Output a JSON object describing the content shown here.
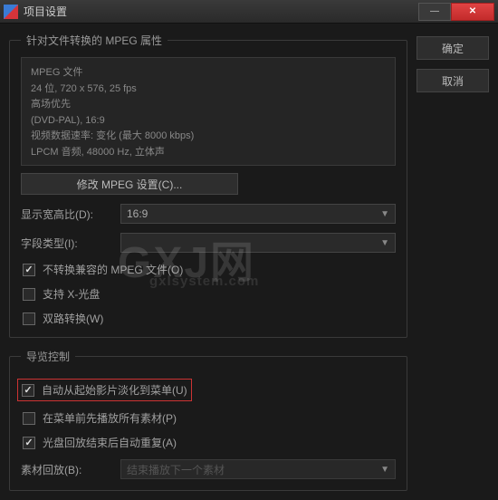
{
  "window": {
    "title": "项目设置"
  },
  "buttons": {
    "ok": "确定",
    "cancel": "取消",
    "modify_mpeg": "修改 MPEG 设置(C)..."
  },
  "mpeg_section": {
    "legend": "针对文件转换的 MPEG 属性",
    "info": {
      "line1": "MPEG 文件",
      "line2": "24 位, 720 x 576, 25 fps",
      "line3": "高场优先",
      "line4": "(DVD-PAL), 16:9",
      "line5": "视频数据速率: 变化 (最大 8000 kbps)",
      "line6": "LPCM 音频, 48000 Hz, 立体声"
    },
    "aspect_label": "显示宽高比(D):",
    "aspect_value": "16:9",
    "field_label": "字段类型(I):",
    "field_value": "",
    "chk_no_convert": "不转换兼容的 MPEG 文件(O)",
    "chk_xdisc": "支持 X-光盘",
    "chk_dualpass": "双路转换(W)"
  },
  "nav_section": {
    "legend": "导览控制",
    "chk_fade": "自动从起始影片淡化到菜单(U)",
    "chk_play_first": "在菜单前先播放所有素材(P)",
    "chk_auto_repeat": "光盘回放结束后自动重复(A)",
    "playback_label": "素材回放(B):",
    "playback_value": "结束播放下一个素材"
  },
  "checks": {
    "no_convert": true,
    "xdisc": false,
    "dualpass": false,
    "fade": true,
    "play_first": false,
    "auto_repeat": true
  },
  "watermark": {
    "main": "GXJ网",
    "sub": "gxlsystem.com"
  }
}
